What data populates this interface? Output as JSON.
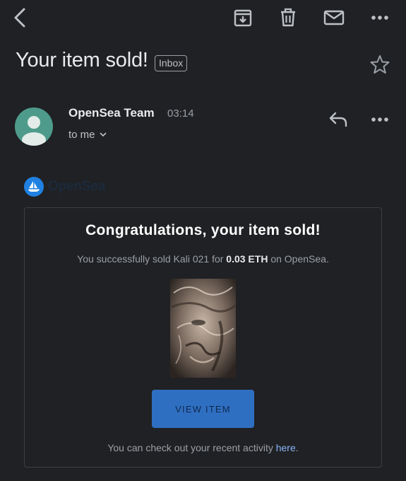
{
  "toolbar": {
    "icons": [
      "back-icon",
      "archive-icon",
      "trash-icon",
      "mail-icon",
      "more-icon"
    ]
  },
  "email": {
    "subject": "Your item sold!",
    "label": "Inbox",
    "sender": "OpenSea Team",
    "time": "03:14",
    "recipients": "to me"
  },
  "brand": {
    "name": "OpenSea",
    "logo_color": "#2081e2"
  },
  "card": {
    "title": "Congratulations, your item sold!",
    "line_prefix": "You successfully sold Kali 021 for",
    "price": "0.03 ETH",
    "line_suffix": "on OpenSea.",
    "button_label": "VIEW ITEM",
    "footer_prefix": "You can check out your recent activity",
    "footer_link": "here",
    "footer_suffix": "."
  },
  "colors": {
    "background": "#202124",
    "accent_button": "#2f6fc2",
    "link": "#8ab4f8",
    "avatar": "#4e9b8b"
  }
}
